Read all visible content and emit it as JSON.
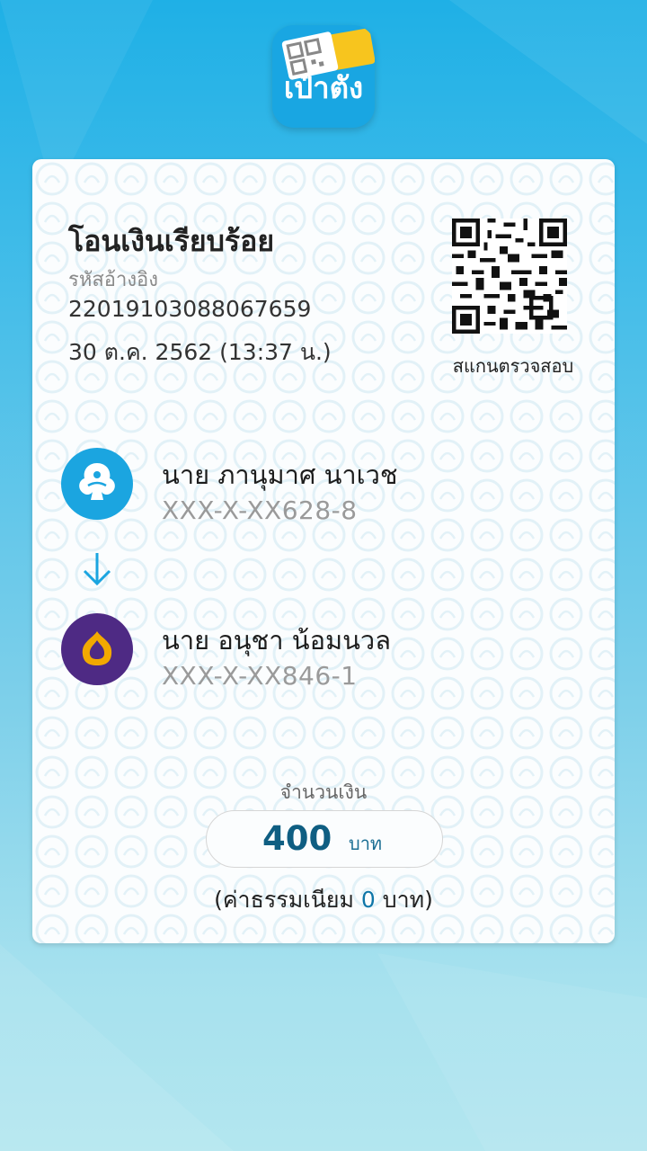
{
  "app": {
    "icon_text": "เป๋าตัง"
  },
  "slip": {
    "title": "โอนเงินเรียบร้อย",
    "ref_label": "รหัสอ้างอิง",
    "ref_value": "22019103088067659",
    "datetime": "30 ต.ค. 2562 (13:37 น.)",
    "qr_label": "สแกนตรวจสอบ"
  },
  "sender": {
    "name": "นาย ภานุมาศ นาเวช",
    "account": "XXX-X-XX628-8",
    "bank_color": "#1ba5e0"
  },
  "receiver": {
    "name": "นาย อนุชา น้อมนวล",
    "account": "XXX-X-XX846-1",
    "bank_color": "#4e2a84"
  },
  "amount": {
    "label": "จำนวนเงิน",
    "value": "400",
    "unit": "บาท"
  },
  "fee": {
    "prefix": "(ค่าธรรมเนียม",
    "value": "0",
    "suffix": "บาท)"
  },
  "colors": {
    "accent": "#0f5e82",
    "background_top": "#1fb0e6",
    "background_bottom": "#b3e6ef"
  }
}
